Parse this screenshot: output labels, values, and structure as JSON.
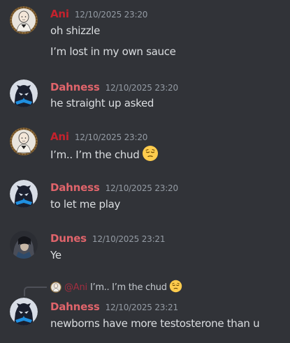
{
  "colors": {
    "background": "#313338",
    "ani": "#c5222d",
    "dahness": "#e0646b",
    "dunes": "#e0646b",
    "timestamp": "#949ba4",
    "text": "#dbdee1"
  },
  "messages": [
    {
      "author": "Ani",
      "timestamp": "12/10/2025 23:20",
      "avatar_icon": "bald-anime-avatar",
      "lines": [
        "oh shizzle",
        "I’m lost in my own sauce"
      ]
    },
    {
      "author": "Dahness",
      "timestamp": "12/10/2025 23:20",
      "avatar_icon": "nightwing-avatar",
      "lines": [
        "he straight up asked"
      ]
    },
    {
      "author": "Ani",
      "timestamp": "12/10/2025 23:20",
      "avatar_icon": "bald-anime-avatar",
      "lines": [
        "I’m.. I’m the chud"
      ],
      "emoji": "pensive-face-emoji"
    },
    {
      "author": "Dahness",
      "timestamp": "12/10/2025 23:20",
      "avatar_icon": "nightwing-avatar",
      "lines": [
        "to let me play"
      ]
    },
    {
      "author": "Dunes",
      "timestamp": "12/10/2025 23:21",
      "avatar_icon": "dark-haired-avatar",
      "lines": [
        "Ye"
      ]
    },
    {
      "author": "Dahness",
      "timestamp": "12/10/2025 23:21",
      "avatar_icon": "nightwing-avatar",
      "lines": [
        "newborns have more testosterone than u"
      ],
      "reply": {
        "mention": "@Ani",
        "text": "I’m.. I’m the chud",
        "emoji": "pensive-face-emoji"
      }
    }
  ]
}
